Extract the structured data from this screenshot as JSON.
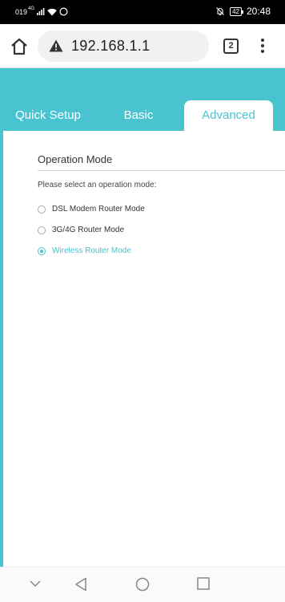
{
  "status_bar": {
    "carrier_text": "019",
    "network_sup": "4G",
    "battery": "42",
    "time": "20:48"
  },
  "browser": {
    "url": "192.168.1.1",
    "tab_count": "2"
  },
  "tabs": [
    {
      "label": "Quick Setup"
    },
    {
      "label": "Basic"
    },
    {
      "label": "Advanced"
    }
  ],
  "section": {
    "title": "Operation Mode",
    "prompt": "Please select an operation mode:"
  },
  "options": [
    {
      "label": "DSL Modem Router Mode",
      "selected": false
    },
    {
      "label": "3G/4G Router Mode",
      "selected": false
    },
    {
      "label": "Wireless Router Mode",
      "selected": true
    }
  ],
  "colors": {
    "accent": "#4ac3d0"
  }
}
